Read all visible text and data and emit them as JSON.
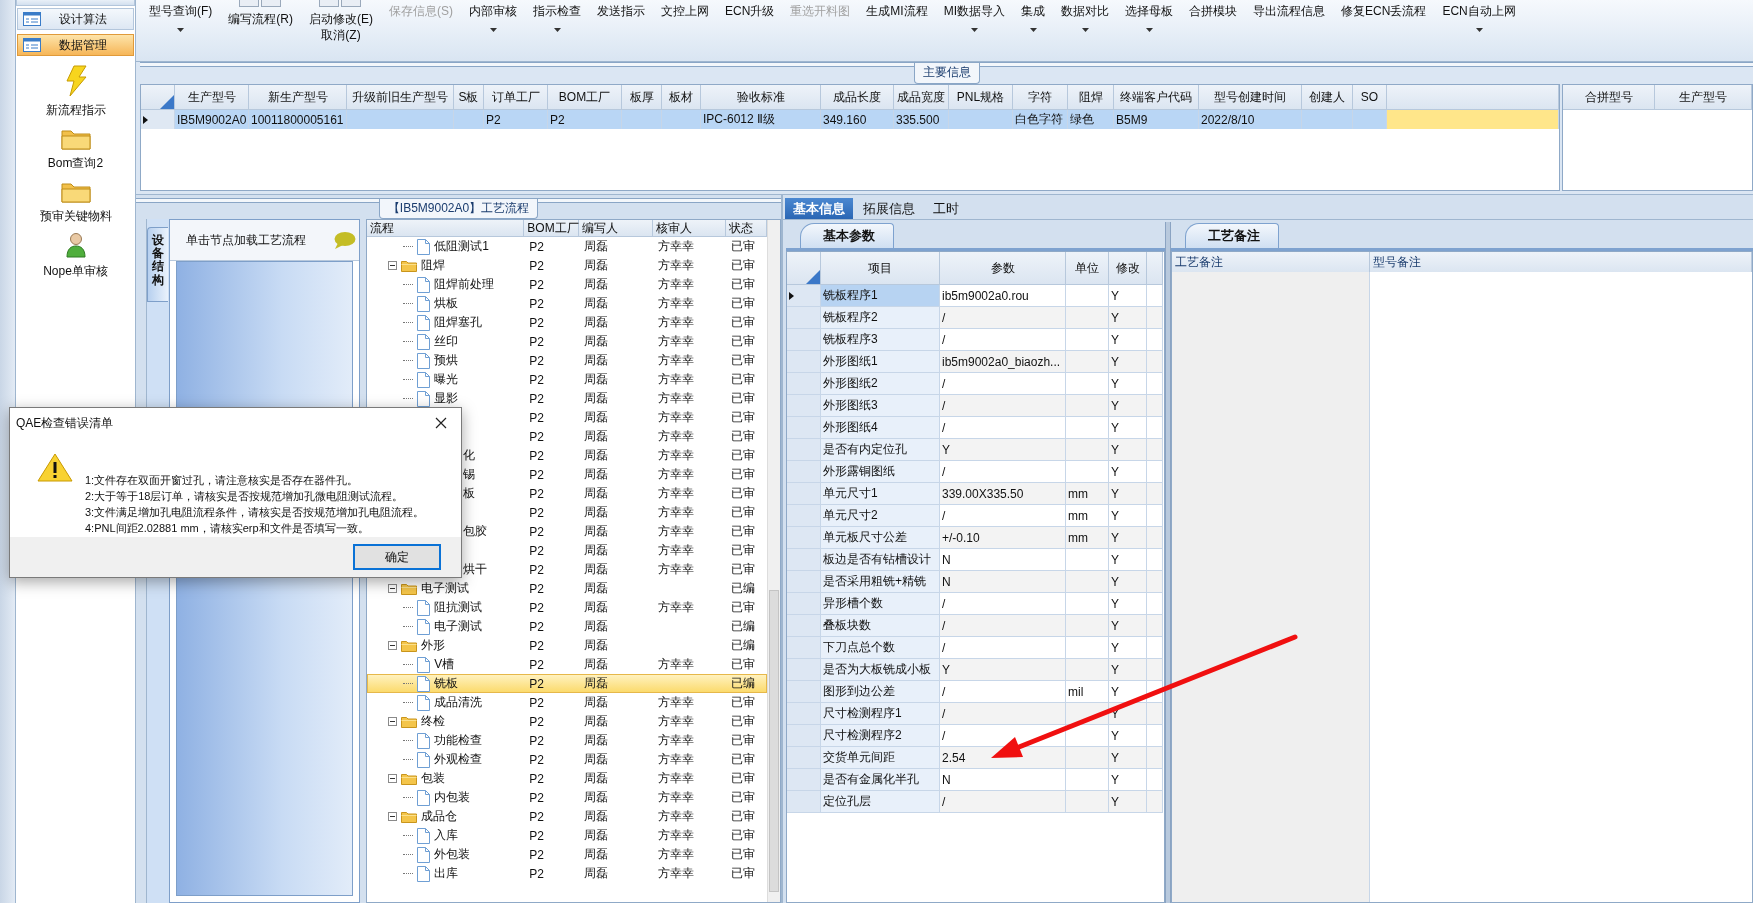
{
  "nav": {
    "items": [
      {
        "label": "设计算法",
        "selected": false
      },
      {
        "label": "数据管理",
        "selected": true
      }
    ],
    "shortcuts": [
      {
        "kind": "lightning",
        "label": "新流程指示"
      },
      {
        "kind": "folder",
        "label": "Bom查询2"
      },
      {
        "kind": "folder",
        "label": "预审关键物料"
      },
      {
        "kind": "person",
        "label": "Nope单审核"
      }
    ]
  },
  "toolbar": {
    "buttons": [
      {
        "label": "型号查询(F)",
        "kind": "small",
        "dropdown": true,
        "disabled": false
      },
      {
        "label": "编写流程(R)",
        "kind": "large",
        "dropdown": false,
        "disabled": false
      },
      {
        "label": "启动修改(E)",
        "second_line": "取消(Z)",
        "kind": "large",
        "dropdown": false,
        "disabled": false
      },
      {
        "label": "保存信息(S)",
        "kind": "small",
        "dropdown": false,
        "disabled": true
      },
      {
        "label": "内部审核",
        "kind": "small",
        "dropdown": true,
        "disabled": false
      },
      {
        "label": "指示检查",
        "kind": "small",
        "dropdown": true,
        "disabled": false
      },
      {
        "label": "发送指示",
        "kind": "small",
        "dropdown": false,
        "disabled": false
      },
      {
        "label": "文控上网",
        "kind": "small",
        "dropdown": false,
        "disabled": false
      },
      {
        "label": "ECN升级",
        "kind": "small",
        "dropdown": false,
        "disabled": false
      },
      {
        "label": "重选开料图",
        "kind": "small",
        "dropdown": false,
        "disabled": true
      },
      {
        "label": "生成MI流程",
        "kind": "small",
        "dropdown": false,
        "disabled": false
      },
      {
        "label": "MI数据导入",
        "kind": "small",
        "dropdown": true,
        "disabled": false
      },
      {
        "label": "集成",
        "kind": "small",
        "dropdown": true,
        "disabled": false
      },
      {
        "label": "数据对比",
        "kind": "small",
        "dropdown": true,
        "disabled": false
      },
      {
        "label": "选择母板",
        "kind": "small",
        "dropdown": true,
        "disabled": false
      },
      {
        "label": "合拼模块",
        "kind": "small",
        "dropdown": false,
        "disabled": false
      },
      {
        "label": "导出流程信息",
        "kind": "small",
        "dropdown": false,
        "disabled": false
      },
      {
        "label": "修复ECN丢流程",
        "kind": "small",
        "dropdown": false,
        "disabled": false
      },
      {
        "label": "ECN自动上网",
        "kind": "small",
        "dropdown": true,
        "disabled": false
      }
    ]
  },
  "main_info": {
    "title": "主要信息",
    "columns": [
      "生产型号",
      "新生产型号",
      "升级前旧生产型号",
      "S板",
      "订单工厂",
      "BOM工厂",
      "板厚",
      "板材",
      "验收标准",
      "成品长度",
      "成品宽度",
      "PNL规格",
      "字符",
      "阻焊",
      "终端客户代码",
      "型号创建时间",
      "创建人",
      "SO"
    ],
    "rows": [
      {
        "selected": true,
        "cells": [
          "IB5M9002A0",
          "10011800005161",
          null,
          null,
          "P2",
          "P2",
          null,
          null,
          "IPC-6012 Ⅱ级",
          "349.160",
          "335.500",
          null,
          "白色字符",
          "绿色",
          "B5M9",
          "2022/8/10",
          null,
          null
        ]
      }
    ],
    "side_columns": [
      "合拼型号",
      "生产型号"
    ]
  },
  "flow": {
    "title": "【IB5M9002A0】工艺流程",
    "side_tab": "设备结构",
    "hint": "单击节点加载工艺流程",
    "columns": [
      "流程",
      "BOM工厂",
      "编写人",
      "核审人",
      "状态"
    ],
    "nodes": [
      {
        "kind": "step",
        "label": "低阻测试1",
        "bom": "P2",
        "writer": "周磊",
        "reviewer": "方幸幸",
        "status": "已审",
        "selected": false
      },
      {
        "kind": "folder",
        "label": "阻焊",
        "expanded": true,
        "bom": "P2",
        "writer": "周磊",
        "reviewer": "方幸幸",
        "status": "已审",
        "selected": false,
        "children": [
          {
            "kind": "step",
            "label": "阻焊前处理",
            "bom": "P2",
            "writer": "周磊",
            "reviewer": "方幸幸",
            "status": "已审",
            "selected": false
          },
          {
            "kind": "step",
            "label": "烘板",
            "bom": "P2",
            "writer": "周磊",
            "reviewer": "方幸幸",
            "status": "已审",
            "selected": false
          },
          {
            "kind": "step",
            "label": "阻焊塞孔",
            "bom": "P2",
            "writer": "周磊",
            "reviewer": "方幸幸",
            "status": "已审",
            "selected": false
          },
          {
            "kind": "step",
            "label": "丝印",
            "bom": "P2",
            "writer": "周磊",
            "reviewer": "方幸幸",
            "status": "已审",
            "selected": false
          },
          {
            "kind": "step",
            "label": "预烘",
            "bom": "P2",
            "writer": "周磊",
            "reviewer": "方幸幸",
            "status": "已审",
            "selected": false
          },
          {
            "kind": "step",
            "label": "曝光",
            "bom": "P2",
            "writer": "周磊",
            "reviewer": "方幸幸",
            "status": "已审",
            "selected": false
          },
          {
            "kind": "step",
            "label": "显影",
            "bom": "P2",
            "writer": "周磊",
            "reviewer": "方幸幸",
            "status": "已审",
            "selected": false
          }
        ]
      },
      {
        "kind": "covered",
        "bom": "P2",
        "writer": "周磊",
        "reviewer": "方幸幸",
        "status": "已审",
        "selected": false
      },
      {
        "kind": "covered",
        "bom": "P2",
        "writer": "周磊",
        "reviewer": "方幸幸",
        "status": "已审",
        "selected": false
      },
      {
        "kind": "covered",
        "label": "化",
        "bom": "P2",
        "writer": "周磊",
        "reviewer": "方幸幸",
        "status": "已审",
        "selected": false
      },
      {
        "kind": "covered",
        "label": "锡",
        "bom": "P2",
        "writer": "周磊",
        "reviewer": "方幸幸",
        "status": "已审",
        "selected": false
      },
      {
        "kind": "covered",
        "label": "板",
        "bom": "P2",
        "writer": "周磊",
        "reviewer": "方幸幸",
        "status": "已审",
        "selected": false
      },
      {
        "kind": "covered",
        "bom": "P2",
        "writer": "周磊",
        "reviewer": "方幸幸",
        "status": "已审",
        "selected": false
      },
      {
        "kind": "covered",
        "label": "包胶",
        "bom": "P2",
        "writer": "周磊",
        "reviewer": "方幸幸",
        "status": "已审",
        "selected": false
      },
      {
        "kind": "covered",
        "bom": "P2",
        "writer": "周磊",
        "reviewer": "方幸幸",
        "status": "已审",
        "selected": false
      },
      {
        "kind": "covered",
        "label": "烘干",
        "bom": "P2",
        "writer": "周磊",
        "reviewer": "方幸幸",
        "status": "已审",
        "selected": false
      },
      {
        "kind": "folder",
        "label": "电子测试",
        "expanded": true,
        "bom": "P2",
        "writer": "周磊",
        "status": "已编",
        "selected": false,
        "children": [
          {
            "kind": "step",
            "label": "阻抗测试",
            "bom": "P2",
            "writer": "周磊",
            "reviewer": "方幸幸",
            "status": "已审",
            "selected": false
          },
          {
            "kind": "step",
            "label": "电子测试",
            "bom": "P2",
            "writer": "周磊",
            "status": "已编",
            "selected": false
          }
        ]
      },
      {
        "kind": "folder",
        "label": "外形",
        "expanded": true,
        "bom": "P2",
        "writer": "周磊",
        "status": "已编",
        "selected": false,
        "children": [
          {
            "kind": "step",
            "label": "V槽",
            "bom": "P2",
            "writer": "周磊",
            "reviewer": "方幸幸",
            "status": "已审",
            "selected": false
          },
          {
            "kind": "step",
            "label": "铣板",
            "bom": "P2",
            "writer": "周磊",
            "status": "已编",
            "selected": true
          },
          {
            "kind": "step",
            "label": "成品清洗",
            "bom": "P2",
            "writer": "周磊",
            "reviewer": "方幸幸",
            "status": "已审",
            "selected": false
          }
        ]
      },
      {
        "kind": "folder",
        "label": "终检",
        "expanded": true,
        "bom": "P2",
        "writer": "周磊",
        "reviewer": "方幸幸",
        "status": "已审",
        "selected": false,
        "children": [
          {
            "kind": "step",
            "label": "功能检查",
            "bom": "P2",
            "writer": "周磊",
            "reviewer": "方幸幸",
            "status": "已审",
            "selected": false
          },
          {
            "kind": "step",
            "label": "外观检查",
            "bom": "P2",
            "writer": "周磊",
            "reviewer": "方幸幸",
            "status": "已审",
            "selected": false
          }
        ]
      },
      {
        "kind": "folder",
        "label": "包装",
        "expanded": true,
        "bom": "P2",
        "writer": "周磊",
        "reviewer": "方幸幸",
        "status": "已审",
        "selected": false,
        "children": [
          {
            "kind": "step",
            "label": "内包装",
            "bom": "P2",
            "writer": "周磊",
            "reviewer": "方幸幸",
            "status": "已审",
            "selected": false
          }
        ]
      },
      {
        "kind": "folder",
        "label": "成品仓",
        "expanded": true,
        "bom": "P2",
        "writer": "周磊",
        "reviewer": "方幸幸",
        "status": "已审",
        "selected": false,
        "children": [
          {
            "kind": "step",
            "label": "入库",
            "bom": "P2",
            "writer": "周磊",
            "reviewer": "方幸幸",
            "status": "已审",
            "selected": false
          },
          {
            "kind": "step",
            "label": "外包装",
            "bom": "P2",
            "writer": "周磊",
            "reviewer": "方幸幸",
            "status": "已审",
            "selected": false
          },
          {
            "kind": "step",
            "label": "出库",
            "bom": "P2",
            "writer": "周磊",
            "reviewer": "方幸幸",
            "status": "已审",
            "selected": false
          }
        ]
      }
    ]
  },
  "params": {
    "tabs": [
      {
        "label": "基本信息",
        "selected": true
      },
      {
        "label": "拓展信息",
        "selected": false
      },
      {
        "label": "工时",
        "selected": false
      }
    ],
    "section": "基本参数",
    "columns": [
      "项目",
      "参数",
      "单位",
      "修改"
    ],
    "rows": [
      {
        "item": "铣板程序1",
        "value": "ib5m9002a0.rou",
        "modified": "Y",
        "selected": true
      },
      {
        "item": "铣板程序2",
        "value": "/",
        "modified": "Y",
        "selected": false
      },
      {
        "item": "铣板程序3",
        "value": "/",
        "modified": "Y",
        "selected": false
      },
      {
        "item": "外形图纸1",
        "value": "ib5m9002a0_biaozh...",
        "modified": "Y",
        "selected": false
      },
      {
        "item": "外形图纸2",
        "value": "/",
        "modified": "Y",
        "selected": false
      },
      {
        "item": "外形图纸3",
        "value": "/",
        "modified": "Y",
        "selected": false
      },
      {
        "item": "外形图纸4",
        "value": "/",
        "modified": "Y",
        "selected": false
      },
      {
        "item": "是否有内定位孔",
        "value": "Y",
        "modified": "Y",
        "selected": false
      },
      {
        "item": "外形露铜图纸",
        "value": "/",
        "modified": "Y",
        "selected": false
      },
      {
        "item": "单元尺寸1",
        "value": "339.00X335.50",
        "unit": "mm",
        "modified": "Y",
        "selected": false
      },
      {
        "item": "单元尺寸2",
        "value": "/",
        "unit": "mm",
        "modified": "Y",
        "selected": false
      },
      {
        "item": "单元板尺寸公差",
        "value": "+/-0.10",
        "unit": "mm",
        "modified": "Y",
        "selected": false
      },
      {
        "item": "板边是否有钻槽设计",
        "value": "N",
        "modified": "Y",
        "selected": false
      },
      {
        "item": "是否采用粗铣+精铣",
        "value": "N",
        "modified": "Y",
        "selected": false
      },
      {
        "item": "异形槽个数",
        "value": "/",
        "modified": "Y",
        "selected": false
      },
      {
        "item": "叠板块数",
        "value": "/",
        "modified": "Y",
        "selected": false
      },
      {
        "item": "下刀点总个数",
        "value": "/",
        "modified": "Y",
        "selected": false
      },
      {
        "item": "是否为大板铣成小板",
        "value": "Y",
        "modified": "Y",
        "selected": false
      },
      {
        "item": "图形到边公差",
        "value": "/",
        "unit": "mil",
        "modified": "Y",
        "selected": false
      },
      {
        "item": "尺寸检测程序1",
        "value": "/",
        "modified": "Y",
        "selected": false
      },
      {
        "item": "尺寸检测程序2",
        "value": "/",
        "modified": "Y",
        "selected": false
      },
      {
        "item": "交货单元间距",
        "value": "2.54",
        "modified": "Y",
        "selected": false
      },
      {
        "item": "是否有金属化半孔",
        "value": "N",
        "modified": "Y",
        "selected": false
      },
      {
        "item": "定位孔层",
        "value": "/",
        "modified": "Y",
        "selected": false
      }
    ]
  },
  "notes": {
    "tab": "工艺备注",
    "columns": [
      "工艺备注",
      "型号备注"
    ]
  },
  "dialog": {
    "title": "QAE检查错误清单",
    "lines": [
      "1:文件存在双面开窗过孔，请注意核实是否存在器件孔。",
      "2:大于等于18层订单，请核实是否按规范增加孔微电阻测试流程。",
      "3:文件满足增加孔电阻流程条件，请核实是否按规范增加孔电阻流程。",
      "4:PNL间距2.02881 mm，请核实erp和文件是否填写一致。"
    ],
    "button": "确定"
  }
}
